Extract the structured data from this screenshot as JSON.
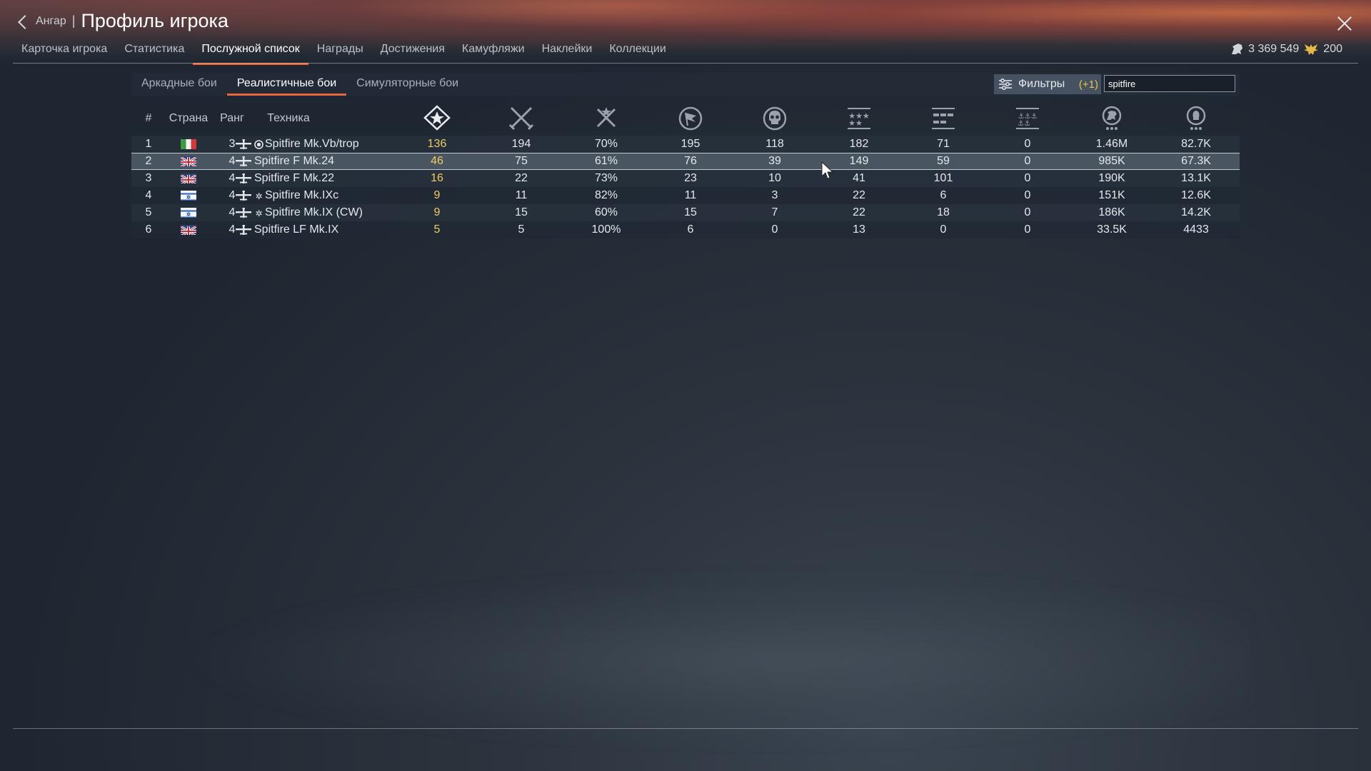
{
  "header": {
    "back_label": "Ангар",
    "separator": "|",
    "title": "Профиль игрока"
  },
  "main_tabs": [
    {
      "label": "Карточка игрока",
      "active": false
    },
    {
      "label": "Статистика",
      "active": false
    },
    {
      "label": "Послужной список",
      "active": true
    },
    {
      "label": "Награды",
      "active": false
    },
    {
      "label": "Достижения",
      "active": false
    },
    {
      "label": "Камуфляжи",
      "active": false
    },
    {
      "label": "Наклейки",
      "active": false
    },
    {
      "label": "Коллекции",
      "active": false
    }
  ],
  "currency": {
    "lions": "3 369 549",
    "golden_eagles": "200"
  },
  "sub_tabs": [
    {
      "label": "Аркадные бои",
      "active": false
    },
    {
      "label": "Реалистичные бои",
      "active": true
    },
    {
      "label": "Симуляторные бои",
      "active": false
    }
  ],
  "filters": {
    "label": "Фильтры",
    "count": "(+1)"
  },
  "search": {
    "value": "spitfire"
  },
  "table": {
    "headers": {
      "num": "#",
      "country": "Страна",
      "rank": "Ранг",
      "vehicle": "Техника"
    },
    "stat_icons": [
      "victories-icon",
      "missions-icon",
      "win-rate-icon",
      "respawns-icon",
      "deaths-icon",
      "air-kills-icon",
      "ground-kills-icon",
      "naval-kills-icon",
      "lions-earned-icon",
      "experience-icon"
    ],
    "rows": [
      {
        "num": "1",
        "flag": "italy",
        "rank": "3",
        "badge": "circle",
        "name": "Spitfire Mk.Vb/trop",
        "victories": "136",
        "battles": "194",
        "winrate": "70%",
        "respawns": "195",
        "deaths": "118",
        "air_kills": "182",
        "ground_kills": "71",
        "naval_kills": "0",
        "lions": "1.46M",
        "research": "82.7K"
      },
      {
        "num": "2",
        "flag": "uk",
        "rank": "4",
        "badge": "",
        "name": "Spitfire F Mk.24",
        "victories": "46",
        "battles": "75",
        "winrate": "61%",
        "respawns": "76",
        "deaths": "39",
        "air_kills": "149",
        "ground_kills": "59",
        "naval_kills": "0",
        "lions": "985K",
        "research": "67.3K",
        "selected": true
      },
      {
        "num": "3",
        "flag": "uk",
        "rank": "4",
        "badge": "",
        "name": "Spitfire F Mk.22",
        "victories": "16",
        "battles": "22",
        "winrate": "73%",
        "respawns": "23",
        "deaths": "10",
        "air_kills": "41",
        "ground_kills": "101",
        "naval_kills": "0",
        "lions": "190K",
        "research": "13.1K"
      },
      {
        "num": "4",
        "flag": "israel",
        "rank": "4",
        "badge": "star",
        "name": "Spitfire Mk.IXc",
        "victories": "9",
        "battles": "11",
        "winrate": "82%",
        "respawns": "11",
        "deaths": "3",
        "air_kills": "22",
        "ground_kills": "6",
        "naval_kills": "0",
        "lions": "151K",
        "research": "12.6K"
      },
      {
        "num": "5",
        "flag": "israel",
        "rank": "4",
        "badge": "star",
        "name": "Spitfire Mk.IX (CW)",
        "victories": "9",
        "battles": "15",
        "winrate": "60%",
        "respawns": "15",
        "deaths": "7",
        "air_kills": "22",
        "ground_kills": "18",
        "naval_kills": "0",
        "lions": "186K",
        "research": "14.2K"
      },
      {
        "num": "6",
        "flag": "uk",
        "rank": "4",
        "badge": "",
        "name": "Spitfire LF Mk.IX",
        "victories": "5",
        "battles": "5",
        "winrate": "100%",
        "respawns": "6",
        "deaths": "0",
        "air_kills": "13",
        "ground_kills": "0",
        "naval_kills": "0",
        "lions": "33.5K",
        "research": "4433"
      }
    ]
  },
  "colors": {
    "accent": "#e8683c",
    "gold": "#f0cc62",
    "background": "#1e2631"
  }
}
